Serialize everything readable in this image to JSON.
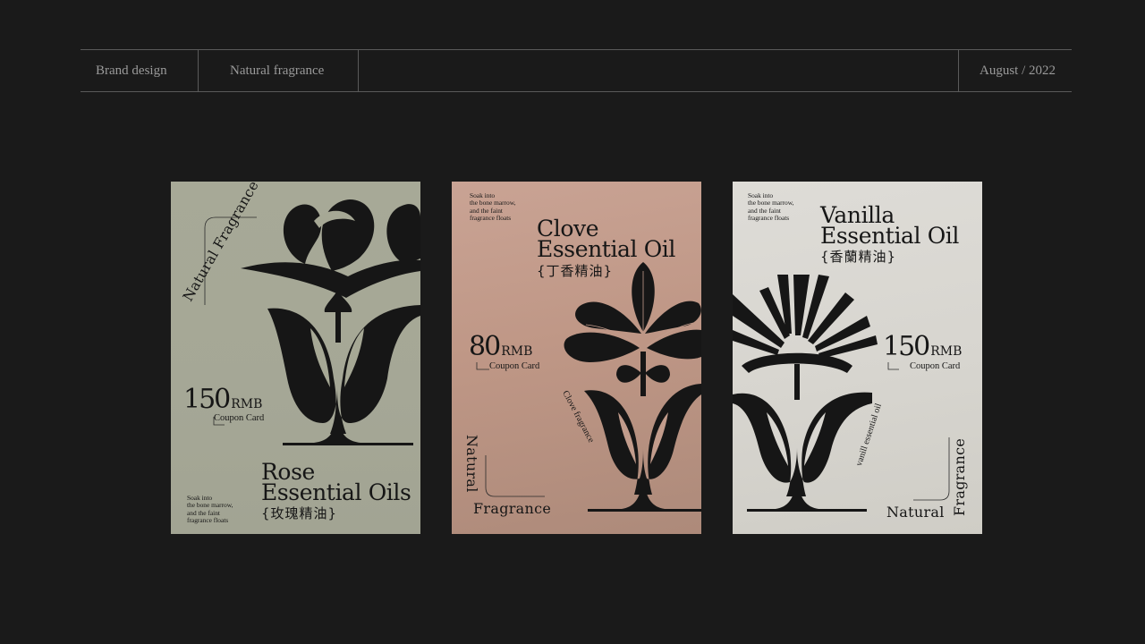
{
  "header": {
    "left": "Brand design",
    "middle": "Natural fragrance",
    "right": "August / 2022"
  },
  "colors": {
    "background": "#1a1a1a",
    "rose_card": "#a6a895",
    "clove_card": "#c29c8c",
    "vanilla_card": "#d8d6d0",
    "ink": "#161616"
  },
  "cards": [
    {
      "title_line1": "Rose",
      "title_line2": "Essential Oils",
      "title_cn": "{玫瑰精油}",
      "price": "150",
      "currency": "RMB",
      "coupon": "Coupon Card",
      "brand": "Natural Fragrance",
      "tagline": [
        "Soak into",
        "the bone marrow,",
        "and the faint",
        "fragrance floats"
      ],
      "art_icon": "rose-flower-icon"
    },
    {
      "title_line1": "Clove",
      "title_line2": "Essential Oil",
      "title_cn": "{丁香精油}",
      "price": "80",
      "currency": "RMB",
      "coupon": "Coupon Card",
      "brand_line1": "Natural",
      "brand_line2": "Fragrance",
      "side_text": "Clove fragrance",
      "tagline": [
        "Soak into",
        "the bone marrow,",
        "and the faint",
        "fragrance floats"
      ],
      "art_icon": "clove-flower-icon"
    },
    {
      "title_line1": "Vanilla",
      "title_line2": "Essential Oil",
      "title_cn": "{香蘭精油}",
      "price": "150",
      "currency": "RMB",
      "coupon": "Coupon Card",
      "brand_line1": "Natural",
      "brand_line2": "Fragrance",
      "side_text": "vanill essential oil",
      "tagline": [
        "Soak into",
        "the bone marrow,",
        "and the faint",
        "fragrance floats"
      ],
      "art_icon": "vanilla-flower-icon"
    }
  ]
}
